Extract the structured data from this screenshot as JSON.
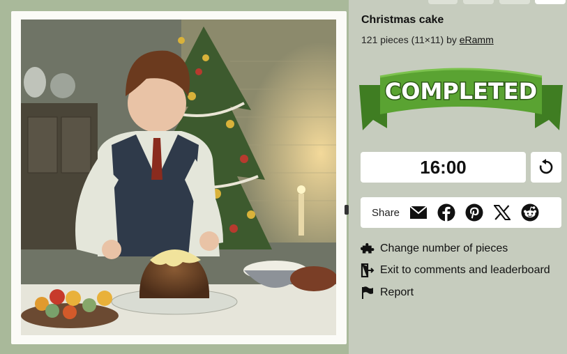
{
  "puzzle": {
    "title": "Christmas cake",
    "pieces_text": "121 pieces (11×11) by ",
    "author": "eRamm"
  },
  "banner": {
    "text": "COMPLETED",
    "color": "#4f9a2d"
  },
  "timer": {
    "value": "16:00"
  },
  "share": {
    "label": "Share"
  },
  "icons": {
    "restart": "restart-icon",
    "email": "email-icon",
    "facebook": "facebook-icon",
    "pinterest": "pinterest-icon",
    "x": "x-icon",
    "reddit": "reddit-icon",
    "puzzle": "puzzle-icon",
    "exit": "exit-icon",
    "flag": "flag-icon"
  },
  "menu": {
    "change_pieces": "Change number of pieces",
    "exit_comments": "Exit to comments and leaderboard",
    "report": "Report"
  }
}
